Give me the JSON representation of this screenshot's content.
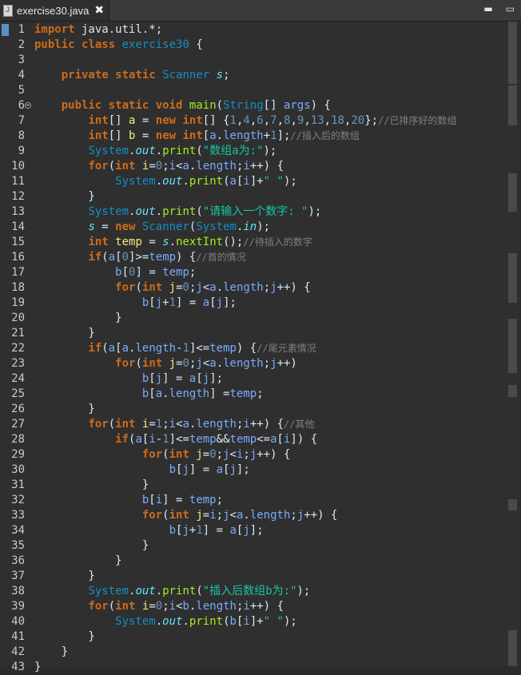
{
  "tab": {
    "title": "exercise30.java",
    "close": "✖"
  },
  "window_controls": {
    "minimize": "▬",
    "maximize": "▭"
  },
  "lines": [
    [
      [
        "kw",
        "import"
      ],
      [
        "txt",
        " java.util.*;"
      ]
    ],
    [
      [
        "kw",
        "public"
      ],
      [
        "txt",
        " "
      ],
      [
        "kw",
        "class"
      ],
      [
        "txt",
        " "
      ],
      [
        "cls",
        "exercise30"
      ],
      [
        "txt",
        " {"
      ]
    ],
    [],
    [
      [
        "txt",
        "    "
      ],
      [
        "kw",
        "private"
      ],
      [
        "txt",
        " "
      ],
      [
        "kw",
        "static"
      ],
      [
        "txt",
        " "
      ],
      [
        "ty",
        "Scanner"
      ],
      [
        "txt",
        " "
      ],
      [
        "fld",
        "s"
      ],
      [
        "txt",
        ";"
      ]
    ],
    [],
    [
      [
        "txt",
        "    "
      ],
      [
        "kw",
        "public"
      ],
      [
        "txt",
        " "
      ],
      [
        "kw",
        "static"
      ],
      [
        "txt",
        " "
      ],
      [
        "kw",
        "void"
      ],
      [
        "txt",
        " "
      ],
      [
        "fn",
        "main"
      ],
      [
        "txt",
        "("
      ],
      [
        "ty",
        "String"
      ],
      [
        "txt",
        "[] "
      ],
      [
        "id",
        "args"
      ],
      [
        "txt",
        ") {"
      ]
    ],
    [
      [
        "txt",
        "        "
      ],
      [
        "kw",
        "int"
      ],
      [
        "txt",
        "[] "
      ],
      [
        "var",
        "a"
      ],
      [
        "txt",
        " = "
      ],
      [
        "kw",
        "new"
      ],
      [
        "txt",
        " "
      ],
      [
        "kw",
        "int"
      ],
      [
        "txt",
        "[] {"
      ],
      [
        "num",
        "1"
      ],
      [
        "txt",
        ","
      ],
      [
        "num",
        "4"
      ],
      [
        "txt",
        ","
      ],
      [
        "num",
        "6"
      ],
      [
        "txt",
        ","
      ],
      [
        "num",
        "7"
      ],
      [
        "txt",
        ","
      ],
      [
        "num",
        "8"
      ],
      [
        "txt",
        ","
      ],
      [
        "num",
        "9"
      ],
      [
        "txt",
        ","
      ],
      [
        "num",
        "13"
      ],
      [
        "txt",
        ","
      ],
      [
        "num",
        "18"
      ],
      [
        "txt",
        ","
      ],
      [
        "num",
        "20"
      ],
      [
        "txt",
        "};"
      ],
      [
        "cmt",
        "//已排序好的数组"
      ]
    ],
    [
      [
        "txt",
        "        "
      ],
      [
        "kw",
        "int"
      ],
      [
        "txt",
        "[] "
      ],
      [
        "var",
        "b"
      ],
      [
        "txt",
        " = "
      ],
      [
        "kw",
        "new"
      ],
      [
        "txt",
        " "
      ],
      [
        "kw",
        "int"
      ],
      [
        "txt",
        "["
      ],
      [
        "id",
        "a"
      ],
      [
        "txt",
        "."
      ],
      [
        "id",
        "length"
      ],
      [
        "txt",
        "+"
      ],
      [
        "num",
        "1"
      ],
      [
        "txt",
        "];"
      ],
      [
        "cmt",
        "//插入后的数组"
      ]
    ],
    [
      [
        "txt",
        "        "
      ],
      [
        "ty",
        "System"
      ],
      [
        "txt",
        "."
      ],
      [
        "fld",
        "out"
      ],
      [
        "txt",
        "."
      ],
      [
        "mcall",
        "print"
      ],
      [
        "txt",
        "("
      ],
      [
        "str",
        "\"数组a为:\""
      ],
      [
        "txt",
        ");"
      ]
    ],
    [
      [
        "txt",
        "        "
      ],
      [
        "kw",
        "for"
      ],
      [
        "txt",
        "("
      ],
      [
        "kw",
        "int"
      ],
      [
        "txt",
        " "
      ],
      [
        "var",
        "i"
      ],
      [
        "txt",
        "="
      ],
      [
        "num",
        "0"
      ],
      [
        "txt",
        ";"
      ],
      [
        "id",
        "i"
      ],
      [
        "txt",
        "<"
      ],
      [
        "id",
        "a"
      ],
      [
        "txt",
        "."
      ],
      [
        "id",
        "length"
      ],
      [
        "txt",
        ";"
      ],
      [
        "id",
        "i"
      ],
      [
        "txt",
        "++) {"
      ]
    ],
    [
      [
        "txt",
        "            "
      ],
      [
        "ty",
        "System"
      ],
      [
        "txt",
        "."
      ],
      [
        "fld",
        "out"
      ],
      [
        "txt",
        "."
      ],
      [
        "mcall",
        "print"
      ],
      [
        "txt",
        "("
      ],
      [
        "id",
        "a"
      ],
      [
        "txt",
        "["
      ],
      [
        "id",
        "i"
      ],
      [
        "txt",
        "]+"
      ],
      [
        "str",
        "\" \""
      ],
      [
        "txt",
        ");"
      ]
    ],
    [
      [
        "txt",
        "        }"
      ]
    ],
    [
      [
        "txt",
        "        "
      ],
      [
        "ty",
        "System"
      ],
      [
        "txt",
        "."
      ],
      [
        "fld",
        "out"
      ],
      [
        "txt",
        "."
      ],
      [
        "mcall",
        "print"
      ],
      [
        "txt",
        "("
      ],
      [
        "str",
        "\"请输入一个数字: \""
      ],
      [
        "txt",
        ");"
      ]
    ],
    [
      [
        "txt",
        "        "
      ],
      [
        "fld",
        "s"
      ],
      [
        "txt",
        " = "
      ],
      [
        "kw",
        "new"
      ],
      [
        "txt",
        " "
      ],
      [
        "ty",
        "Scanner"
      ],
      [
        "txt",
        "("
      ],
      [
        "ty",
        "System"
      ],
      [
        "txt",
        "."
      ],
      [
        "fld",
        "in"
      ],
      [
        "txt",
        ");"
      ]
    ],
    [
      [
        "txt",
        "        "
      ],
      [
        "kw",
        "int"
      ],
      [
        "txt",
        " "
      ],
      [
        "var",
        "temp"
      ],
      [
        "txt",
        " = "
      ],
      [
        "fld",
        "s"
      ],
      [
        "txt",
        "."
      ],
      [
        "mcall",
        "nextInt"
      ],
      [
        "txt",
        "();"
      ],
      [
        "cmt",
        "//待插入的数字"
      ]
    ],
    [
      [
        "txt",
        "        "
      ],
      [
        "kw",
        "if"
      ],
      [
        "txt",
        "("
      ],
      [
        "id",
        "a"
      ],
      [
        "txt",
        "["
      ],
      [
        "num",
        "0"
      ],
      [
        "txt",
        "]>="
      ],
      [
        "id",
        "temp"
      ],
      [
        "txt",
        ") {"
      ],
      [
        "cmt",
        "//首的情况"
      ]
    ],
    [
      [
        "txt",
        "            "
      ],
      [
        "id",
        "b"
      ],
      [
        "txt",
        "["
      ],
      [
        "num",
        "0"
      ],
      [
        "txt",
        "] = "
      ],
      [
        "id",
        "temp"
      ],
      [
        "txt",
        ";"
      ]
    ],
    [
      [
        "txt",
        "            "
      ],
      [
        "kw",
        "for"
      ],
      [
        "txt",
        "("
      ],
      [
        "kw",
        "int"
      ],
      [
        "txt",
        " "
      ],
      [
        "var",
        "j"
      ],
      [
        "txt",
        "="
      ],
      [
        "num",
        "0"
      ],
      [
        "txt",
        ";"
      ],
      [
        "id",
        "j"
      ],
      [
        "txt",
        "<"
      ],
      [
        "id",
        "a"
      ],
      [
        "txt",
        "."
      ],
      [
        "id",
        "length"
      ],
      [
        "txt",
        ";"
      ],
      [
        "id",
        "j"
      ],
      [
        "txt",
        "++) {"
      ]
    ],
    [
      [
        "txt",
        "                "
      ],
      [
        "id",
        "b"
      ],
      [
        "txt",
        "["
      ],
      [
        "id",
        "j"
      ],
      [
        "txt",
        "+"
      ],
      [
        "num",
        "1"
      ],
      [
        "txt",
        "] = "
      ],
      [
        "id",
        "a"
      ],
      [
        "txt",
        "["
      ],
      [
        "id",
        "j"
      ],
      [
        "txt",
        "];"
      ]
    ],
    [
      [
        "txt",
        "            }"
      ]
    ],
    [
      [
        "txt",
        "        }"
      ]
    ],
    [
      [
        "txt",
        "        "
      ],
      [
        "kw",
        "if"
      ],
      [
        "txt",
        "("
      ],
      [
        "id",
        "a"
      ],
      [
        "txt",
        "["
      ],
      [
        "id",
        "a"
      ],
      [
        "txt",
        "."
      ],
      [
        "id",
        "length"
      ],
      [
        "txt",
        "-"
      ],
      [
        "num",
        "1"
      ],
      [
        "txt",
        "]<="
      ],
      [
        "id",
        "temp"
      ],
      [
        "txt",
        ") {"
      ],
      [
        "cmt",
        "//尾元素情况"
      ]
    ],
    [
      [
        "txt",
        "            "
      ],
      [
        "kw",
        "for"
      ],
      [
        "txt",
        "("
      ],
      [
        "kw",
        "int"
      ],
      [
        "txt",
        " "
      ],
      [
        "var",
        "j"
      ],
      [
        "txt",
        "="
      ],
      [
        "num",
        "0"
      ],
      [
        "txt",
        ";"
      ],
      [
        "id",
        "j"
      ],
      [
        "txt",
        "<"
      ],
      [
        "id",
        "a"
      ],
      [
        "txt",
        "."
      ],
      [
        "id",
        "length"
      ],
      [
        "txt",
        ";"
      ],
      [
        "id",
        "j"
      ],
      [
        "txt",
        "++)"
      ]
    ],
    [
      [
        "txt",
        "                "
      ],
      [
        "id",
        "b"
      ],
      [
        "txt",
        "["
      ],
      [
        "id",
        "j"
      ],
      [
        "txt",
        "] = "
      ],
      [
        "id",
        "a"
      ],
      [
        "txt",
        "["
      ],
      [
        "id",
        "j"
      ],
      [
        "txt",
        "];"
      ]
    ],
    [
      [
        "txt",
        "                "
      ],
      [
        "id",
        "b"
      ],
      [
        "txt",
        "["
      ],
      [
        "id",
        "a"
      ],
      [
        "txt",
        "."
      ],
      [
        "id",
        "length"
      ],
      [
        "txt",
        "] ="
      ],
      [
        "id",
        "temp"
      ],
      [
        "txt",
        ";"
      ]
    ],
    [
      [
        "txt",
        "        }"
      ]
    ],
    [
      [
        "txt",
        "        "
      ],
      [
        "kw",
        "for"
      ],
      [
        "txt",
        "("
      ],
      [
        "kw",
        "int"
      ],
      [
        "txt",
        " "
      ],
      [
        "var",
        "i"
      ],
      [
        "txt",
        "="
      ],
      [
        "num",
        "1"
      ],
      [
        "txt",
        ";"
      ],
      [
        "id",
        "i"
      ],
      [
        "txt",
        "<"
      ],
      [
        "id",
        "a"
      ],
      [
        "txt",
        "."
      ],
      [
        "id",
        "length"
      ],
      [
        "txt",
        ";"
      ],
      [
        "id",
        "i"
      ],
      [
        "txt",
        "++) {"
      ],
      [
        "cmt",
        "//其他"
      ]
    ],
    [
      [
        "txt",
        "            "
      ],
      [
        "kw",
        "if"
      ],
      [
        "txt",
        "("
      ],
      [
        "id",
        "a"
      ],
      [
        "txt",
        "["
      ],
      [
        "id",
        "i"
      ],
      [
        "txt",
        "-"
      ],
      [
        "num",
        "1"
      ],
      [
        "txt",
        "]<="
      ],
      [
        "id",
        "temp"
      ],
      [
        "txt",
        "&&"
      ],
      [
        "id",
        "temp"
      ],
      [
        "txt",
        "<="
      ],
      [
        "id",
        "a"
      ],
      [
        "txt",
        "["
      ],
      [
        "id",
        "i"
      ],
      [
        "txt",
        "]) {"
      ]
    ],
    [
      [
        "txt",
        "                "
      ],
      [
        "kw",
        "for"
      ],
      [
        "txt",
        "("
      ],
      [
        "kw",
        "int"
      ],
      [
        "txt",
        " "
      ],
      [
        "var",
        "j"
      ],
      [
        "txt",
        "="
      ],
      [
        "num",
        "0"
      ],
      [
        "txt",
        ";"
      ],
      [
        "id",
        "j"
      ],
      [
        "txt",
        "<"
      ],
      [
        "id",
        "i"
      ],
      [
        "txt",
        ";"
      ],
      [
        "id",
        "j"
      ],
      [
        "txt",
        "++) {"
      ]
    ],
    [
      [
        "txt",
        "                    "
      ],
      [
        "id",
        "b"
      ],
      [
        "txt",
        "["
      ],
      [
        "id",
        "j"
      ],
      [
        "txt",
        "] = "
      ],
      [
        "id",
        "a"
      ],
      [
        "txt",
        "["
      ],
      [
        "id",
        "j"
      ],
      [
        "txt",
        "];"
      ]
    ],
    [
      [
        "txt",
        "                }"
      ]
    ],
    [
      [
        "txt",
        "                "
      ],
      [
        "id",
        "b"
      ],
      [
        "txt",
        "["
      ],
      [
        "id",
        "i"
      ],
      [
        "txt",
        "] = "
      ],
      [
        "id",
        "temp"
      ],
      [
        "txt",
        ";"
      ]
    ],
    [
      [
        "txt",
        "                "
      ],
      [
        "kw",
        "for"
      ],
      [
        "txt",
        "("
      ],
      [
        "kw",
        "int"
      ],
      [
        "txt",
        " "
      ],
      [
        "var",
        "j"
      ],
      [
        "txt",
        "="
      ],
      [
        "id",
        "i"
      ],
      [
        "txt",
        ";"
      ],
      [
        "id",
        "j"
      ],
      [
        "txt",
        "<"
      ],
      [
        "id",
        "a"
      ],
      [
        "txt",
        "."
      ],
      [
        "id",
        "length"
      ],
      [
        "txt",
        ";"
      ],
      [
        "id",
        "j"
      ],
      [
        "txt",
        "++) {"
      ]
    ],
    [
      [
        "txt",
        "                    "
      ],
      [
        "id",
        "b"
      ],
      [
        "txt",
        "["
      ],
      [
        "id",
        "j"
      ],
      [
        "txt",
        "+"
      ],
      [
        "num",
        "1"
      ],
      [
        "txt",
        "] = "
      ],
      [
        "id",
        "a"
      ],
      [
        "txt",
        "["
      ],
      [
        "id",
        "j"
      ],
      [
        "txt",
        "];"
      ]
    ],
    [
      [
        "txt",
        "                }"
      ]
    ],
    [
      [
        "txt",
        "            }"
      ]
    ],
    [
      [
        "txt",
        "        }"
      ]
    ],
    [
      [
        "txt",
        "        "
      ],
      [
        "ty",
        "System"
      ],
      [
        "txt",
        "."
      ],
      [
        "fld",
        "out"
      ],
      [
        "txt",
        "."
      ],
      [
        "mcall",
        "print"
      ],
      [
        "txt",
        "("
      ],
      [
        "str",
        "\"插入后数组b为:\""
      ],
      [
        "txt",
        ");"
      ]
    ],
    [
      [
        "txt",
        "        "
      ],
      [
        "kw",
        "for"
      ],
      [
        "txt",
        "("
      ],
      [
        "kw",
        "int"
      ],
      [
        "txt",
        " "
      ],
      [
        "var",
        "i"
      ],
      [
        "txt",
        "="
      ],
      [
        "num",
        "0"
      ],
      [
        "txt",
        ";"
      ],
      [
        "id",
        "i"
      ],
      [
        "txt",
        "<"
      ],
      [
        "id",
        "b"
      ],
      [
        "txt",
        "."
      ],
      [
        "id",
        "length"
      ],
      [
        "txt",
        ";"
      ],
      [
        "id",
        "i"
      ],
      [
        "txt",
        "++) {"
      ]
    ],
    [
      [
        "txt",
        "            "
      ],
      [
        "ty",
        "System"
      ],
      [
        "txt",
        "."
      ],
      [
        "fld",
        "out"
      ],
      [
        "txt",
        "."
      ],
      [
        "mcall",
        "print"
      ],
      [
        "txt",
        "("
      ],
      [
        "id",
        "b"
      ],
      [
        "txt",
        "["
      ],
      [
        "id",
        "i"
      ],
      [
        "txt",
        "]+"
      ],
      [
        "str",
        "\" \""
      ],
      [
        "txt",
        ");"
      ]
    ],
    [
      [
        "txt",
        "        }"
      ]
    ],
    [
      [
        "txt",
        "    }"
      ]
    ],
    [
      [
        "txt",
        "}"
      ]
    ]
  ],
  "fold_line": 6,
  "colors": {
    "background": "#2f2f2f",
    "keyword": "#cc6c1d",
    "type": "#1290c3",
    "method": "#a7ec21",
    "number": "#6897bb",
    "string": "#17c6a3",
    "comment": "#808080",
    "local_var": "#f3ec79",
    "static_field": "#66e1f8"
  }
}
